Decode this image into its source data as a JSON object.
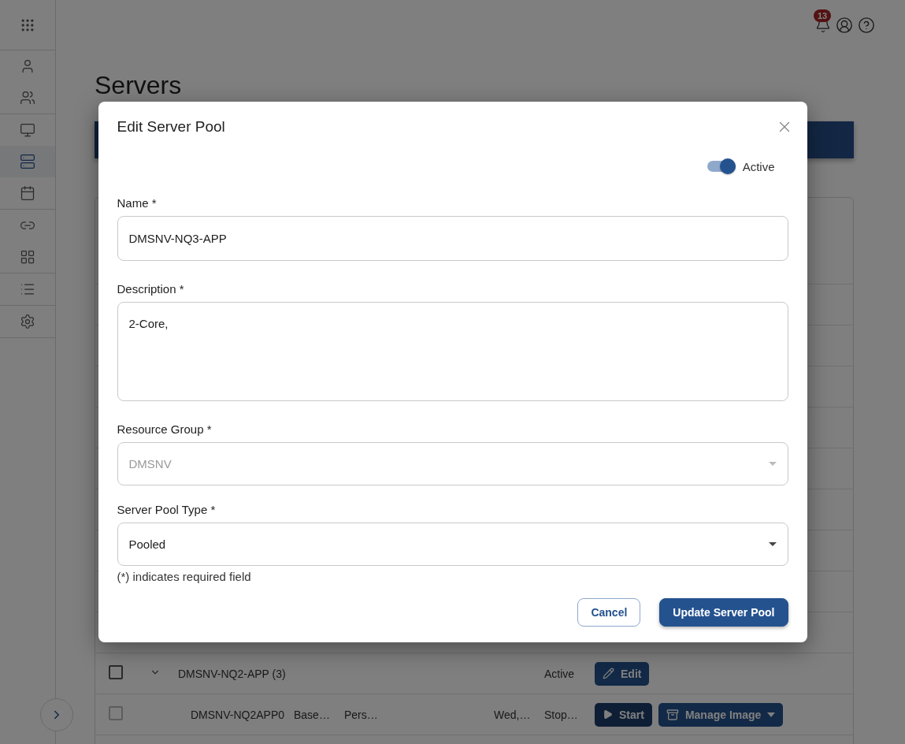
{
  "header": {
    "notifications_badge": "13"
  },
  "sidebar": {
    "groups": [
      {
        "items": [
          {
            "selected": false
          },
          {
            "selected": false
          }
        ]
      },
      {
        "items": [
          {
            "selected": false
          },
          {
            "selected": true
          },
          {
            "selected": false
          }
        ]
      },
      {
        "items": [
          {
            "selected": false
          },
          {
            "selected": false
          }
        ]
      },
      {
        "items": [
          {
            "selected": false
          }
        ]
      },
      {
        "items": [
          {
            "selected": false
          }
        ]
      }
    ]
  },
  "page": {
    "title": "Servers"
  },
  "table": {
    "rows": [
      {
        "kind": "group",
        "checked": false,
        "expanded": true,
        "name": "DMSNV-NQ2-APP (3)",
        "status": "Active",
        "actions": [
          {
            "kind": "edit",
            "label": "Edit"
          }
        ]
      },
      {
        "kind": "server",
        "checked": false,
        "name": "DMSNV-NQ2APP0",
        "column_3": "Base…",
        "column_4": "Pers…",
        "column_5": "Wed,…",
        "status": "Stop…",
        "actions": [
          {
            "kind": "start",
            "label": "Start"
          },
          {
            "kind": "manage",
            "label": "Manage Image"
          }
        ]
      }
    ]
  },
  "dialog": {
    "title": "Edit Server Pool",
    "active_toggle": {
      "label": "Active",
      "on": true
    },
    "fields": [
      {
        "kind": "text",
        "label": "Name *",
        "value": "DMSNV-NQ3-APP",
        "disabled": false
      },
      {
        "kind": "textarea",
        "label": "Description *",
        "value": "2-Core,",
        "disabled": false
      },
      {
        "kind": "select",
        "label": "Resource Group *",
        "value": "DMSNV",
        "disabled": true
      },
      {
        "kind": "select",
        "label": "Server Pool Type *",
        "value": "Pooled",
        "disabled": false
      }
    ],
    "note": "(*) indicates required field",
    "buttons": [
      {
        "kind": "secondary",
        "label": "Cancel"
      },
      {
        "kind": "primary",
        "label": "Update Server Pool"
      }
    ]
  }
}
